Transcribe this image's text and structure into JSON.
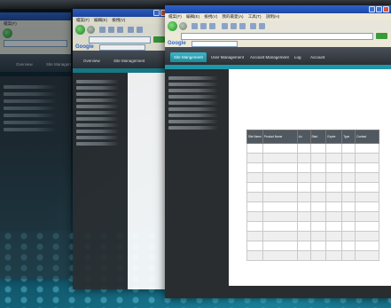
{
  "browser": {
    "menu": [
      "檔案(F)",
      "編輯(E)",
      "檢視(V)",
      "我的最愛(A)",
      "工具(T)",
      "說明(H)"
    ],
    "back_label": "上一頁",
    "google_label": "Google"
  },
  "windows": [
    {
      "tabs": [
        "Overview",
        "Site Management"
      ]
    },
    {
      "tabs": [
        "Overview",
        "Site Management"
      ]
    },
    {
      "tabs": [
        "Site Mangement",
        "User Management",
        "Account Management",
        "Log",
        "Account"
      ],
      "table_headers": [
        "Site Name",
        "Product Name",
        "Lic",
        "Start",
        "Expire",
        "Type",
        "Contact"
      ],
      "row_count": 12
    }
  ]
}
